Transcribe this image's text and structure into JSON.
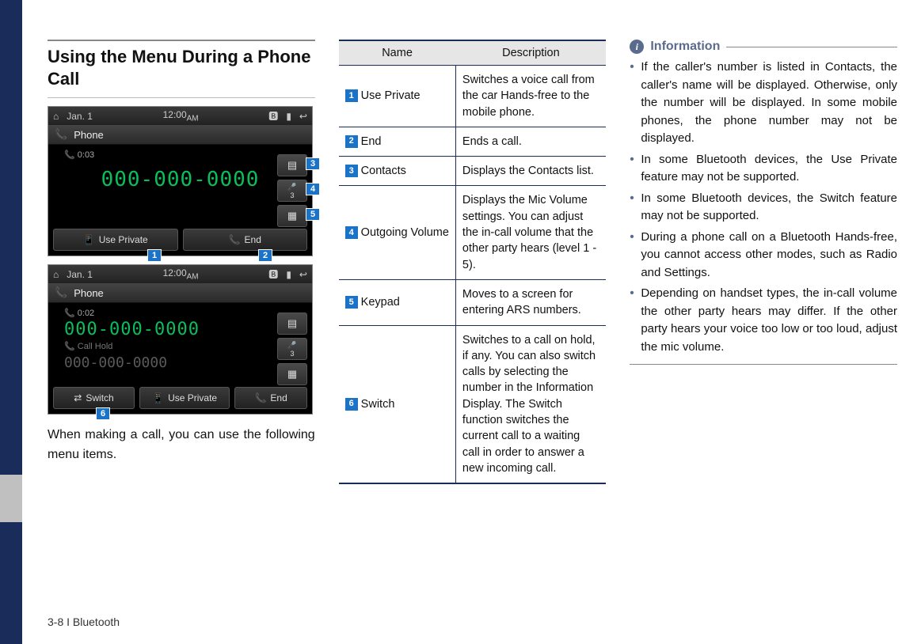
{
  "heading": "Using the Menu During a Phone Call",
  "screenshot_a": {
    "status_date": "Jan. 1",
    "status_time": "12:00",
    "status_ampm": "AM",
    "phone_label": "Phone",
    "timer": "0:03",
    "number": "000-000-0000",
    "side_volume_level": "3",
    "bottom_left": "Use Private",
    "bottom_right": "End"
  },
  "screenshot_b": {
    "status_date": "Jan. 1",
    "status_time": "12:00",
    "status_ampm": "AM",
    "phone_label": "Phone",
    "timer": "0:02",
    "number_active": "000-000-0000",
    "hold_label": "Call Hold",
    "number_hold": "000-000-0000",
    "side_volume_level": "3",
    "bottom_switch": "Switch",
    "bottom_private": "Use Private",
    "bottom_end": "End"
  },
  "markers": {
    "m1": "1",
    "m2": "2",
    "m3": "3",
    "m4": "4",
    "m5": "5",
    "m6": "6"
  },
  "intro_text": "When making a call, you can use the following menu items.",
  "table": {
    "header_name": "Name",
    "header_desc": "Description",
    "rows": [
      {
        "num": "1",
        "name": "Use Private",
        "desc": "Switches a voice call from the car Hands-free to the mobile phone."
      },
      {
        "num": "2",
        "name": "End",
        "desc": "Ends a call."
      },
      {
        "num": "3",
        "name": "Contacts",
        "desc": "Displays the Contacts list."
      },
      {
        "num": "4",
        "name": "Outgoing Volume",
        "desc": "Displays the Mic Volume settings. You can adjust the in-call volume that the other party hears (level 1 - 5)."
      },
      {
        "num": "5",
        "name": "Keypad",
        "desc": "Moves to a screen for entering ARS numbers."
      },
      {
        "num": "6",
        "name": "Switch",
        "desc": "Switches to a call on hold, if any. You can also switch calls by selecting the number in the Information Display. The Switch function switches the current call to a waiting call in order to answer a new incoming call."
      }
    ]
  },
  "info": {
    "title": "Information",
    "items": [
      "If the caller's number is listed in Contacts, the caller's name will be displayed. Otherwise, only the number will be displayed. In some mobile phones, the phone number may not be displayed.",
      "In some Bluetooth devices, the Use Private feature may not be supported.",
      "In some Bluetooth devices, the Switch feature may not be supported.",
      "During a phone call on a Bluetooth Hands-free, you cannot access other modes, such as Radio and Settings.",
      "Depending on handset types, the in-call volume the other party hears may differ. If the other party hears your voice too low or too loud, adjust the mic volume."
    ]
  },
  "footer": "3-8 I Bluetooth"
}
